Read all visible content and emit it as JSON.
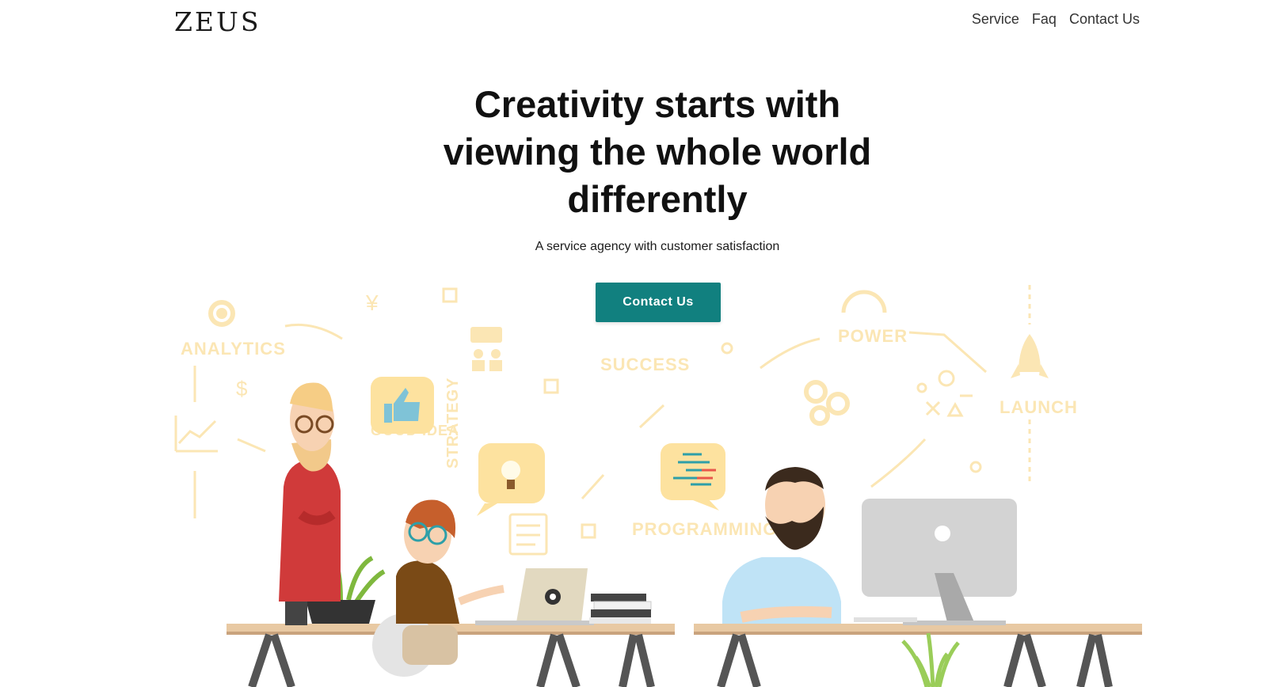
{
  "header": {
    "brand": "ZEUS",
    "nav": [
      "Service",
      "Faq",
      "Contact Us"
    ]
  },
  "hero": {
    "title_lines": [
      "Creativity starts with",
      "viewing the whole world",
      "differently"
    ],
    "subtitle": "A service agency with customer satisfaction",
    "cta_label": "Contact Us"
  },
  "illustration": {
    "doodle_labels": [
      "ANALYTICS",
      "SUCCESS",
      "POWER",
      "GOOD IDEA",
      "STRATEGY",
      "PROGRAMMING",
      "LAUNCH"
    ]
  },
  "colors": {
    "accent": "#11807f",
    "doodle": "#fbe6b4",
    "desk": "#e8c9a3",
    "desk_legs": "#555555"
  }
}
